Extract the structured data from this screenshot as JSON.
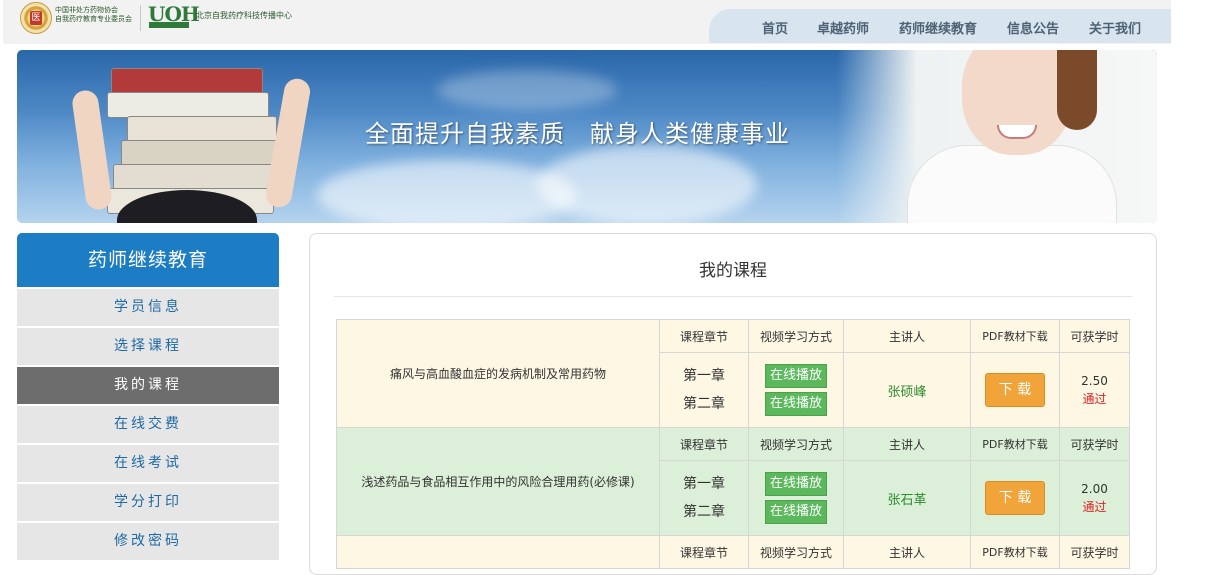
{
  "header": {
    "org_line1": "中国非处方药物协会",
    "org_line2": "自我药疗教育专业委员会",
    "center_name": "北京自我药疗科技传播中心",
    "nav": [
      "首页",
      "卓越药师",
      "药师继续教育",
      "信息公告",
      "关于我们"
    ]
  },
  "banner": {
    "slogan": "全面提升自我素质　献身人类健康事业"
  },
  "sidebar": {
    "title": "药师继续教育",
    "items": [
      "学员信息",
      "选择课程",
      "我的课程",
      "在线交费",
      "在线考试",
      "学分打印",
      "修改密码"
    ],
    "active_index": 2
  },
  "main": {
    "title": "我的课程",
    "columns": [
      "课程章节",
      "视频学习方式",
      "主讲人",
      "PDF教材下载",
      "可获学时"
    ],
    "courses": [
      {
        "name": "痛风与高血酸血症的发病机制及常用药物",
        "chapters": [
          "第一章",
          "第二章"
        ],
        "play_label": "在线播放",
        "lecturer": "张硕峰",
        "download_label": "下 载",
        "hours": "2.50",
        "status": "通过"
      },
      {
        "name": "浅述药品与食品相互作用中的风险合理用药(必修课)",
        "chapters": [
          "第一章",
          "第二章"
        ],
        "play_label": "在线播放",
        "lecturer": "张石革",
        "download_label": "下 载",
        "hours": "2.00",
        "status": "通过"
      }
    ]
  },
  "colors": {
    "nav_bg": "#d8e5ef",
    "sidebar_head": "#1c7cc4",
    "sidebar_active": "#6d6d6d",
    "play_button": "#5cb85c",
    "download_button": "#f0a43a",
    "lecturer_text": "#2e8b2e",
    "status_text": "#dd2222"
  }
}
